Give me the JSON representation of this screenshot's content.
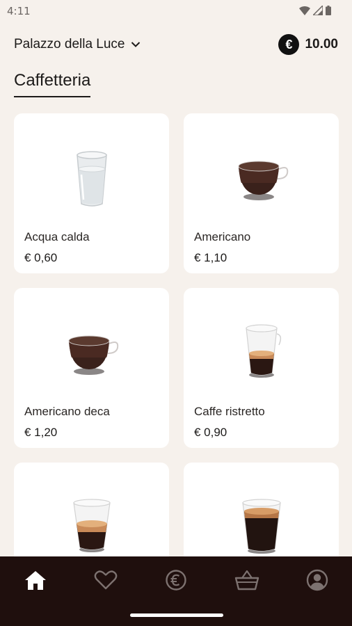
{
  "status_bar": {
    "time": "4:11"
  },
  "header": {
    "location": "Palazzo della Luce",
    "currency_symbol": "€",
    "balance": "10.00"
  },
  "section": {
    "title": "Caffetteria"
  },
  "products": [
    {
      "name": "Acqua calda",
      "price": "€ 0,60"
    },
    {
      "name": "Americano",
      "price": "€ 1,10"
    },
    {
      "name": "Americano deca",
      "price": "€ 1,20"
    },
    {
      "name": "Caffe ristretto",
      "price": "€ 0,90"
    },
    {
      "name": "",
      "price": ""
    },
    {
      "name": "",
      "price": ""
    }
  ],
  "bottom_nav": {
    "items": [
      {
        "icon": "home-icon",
        "active": true
      },
      {
        "icon": "heart-icon",
        "active": false
      },
      {
        "icon": "euro-icon",
        "active": false
      },
      {
        "icon": "basket-icon",
        "active": false
      },
      {
        "icon": "account-icon",
        "active": false
      }
    ]
  },
  "colors": {
    "background": "#f6f1ec",
    "nav_bar": "#1f0f0d",
    "card": "#ffffff",
    "text": "#1c1a19"
  }
}
